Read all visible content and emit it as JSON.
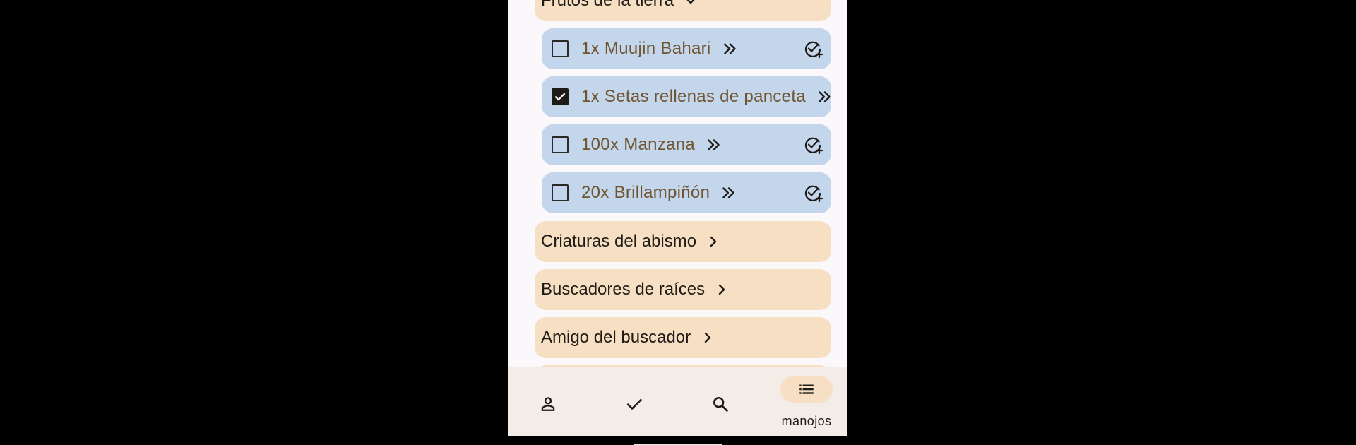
{
  "expanded_category": {
    "label": "Frutos de la tierra",
    "icon": "chevron-down-icon"
  },
  "items": [
    {
      "label": "1x Muujin Bahari",
      "checked": false
    },
    {
      "label": "1x Setas rellenas de panceta",
      "checked": true
    },
    {
      "label": "100x Manzana",
      "checked": false
    },
    {
      "label": "20x Brillampiñón",
      "checked": false
    }
  ],
  "categories": [
    {
      "label": "Criaturas del abismo"
    },
    {
      "label": "Buscadores de raíces"
    },
    {
      "label": "Amigo del buscador"
    }
  ],
  "nav": {
    "items": [
      {
        "icon": "person-icon"
      },
      {
        "icon": "check-icon"
      },
      {
        "icon": "search-icon"
      },
      {
        "icon": "list-icon",
        "label": "manojos",
        "active": true
      }
    ]
  },
  "colors": {
    "category_bg": "#f6dfc2",
    "item_bg": "#c3d6ec",
    "item_text": "#6f5630",
    "screen_bg": "#fbf8fb",
    "nav_bg": "#f3ece7"
  }
}
